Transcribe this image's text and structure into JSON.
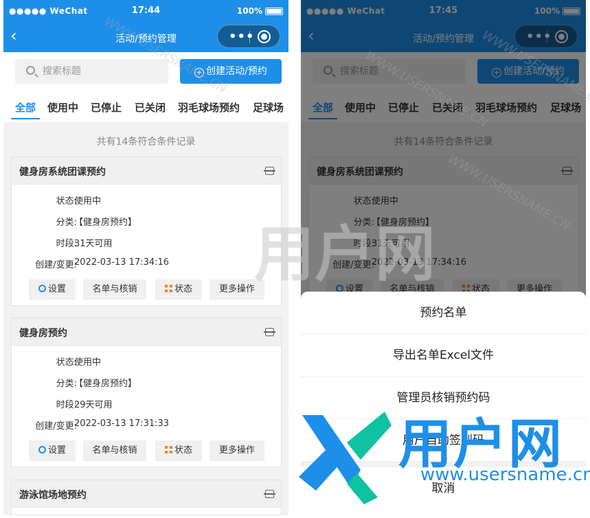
{
  "status_bar_left": {
    "carrier": "●●●●● WeChat",
    "time": "17:44",
    "battery": "100%"
  },
  "status_bar_right": {
    "carrier": "●●●●● WeChat",
    "time": "17:45",
    "battery": "100%"
  },
  "navbar": {
    "title": "活动/预约管理",
    "back_icon": "‹",
    "capsule_dots": "•••"
  },
  "search": {
    "placeholder": "搜索标题"
  },
  "create_button": {
    "label": "创建活动/预约"
  },
  "tabs": [
    "全部",
    "使用中",
    "已停止",
    "已关闭",
    "羽毛球场预约",
    "足球场"
  ],
  "record_count": "共有14条符合条件记录",
  "labels": {
    "status": "状态:",
    "category": "分类:",
    "period": "时段:",
    "updated": "创建/变更:"
  },
  "action_buttons": {
    "settings": "设置",
    "roster": "名单与核销",
    "status": "状态",
    "more": "更多操作"
  },
  "cards": [
    {
      "title": "健身房系统团课预约",
      "status": "使用中",
      "category": "【健身房预约】",
      "period": "31天可用",
      "updated": "2022-03-13 17:34:16"
    },
    {
      "title": "健身房预约",
      "status": "使用中",
      "category": "【健身房预约】",
      "period": "29天可用",
      "updated": "2022-03-13 17:31:33"
    },
    {
      "title": "游泳馆场地预约"
    }
  ],
  "action_sheet": {
    "items": [
      "预约名单",
      "导出名单Excel文件",
      "管理员核销预约码",
      "用户自助签到码"
    ],
    "cancel": "取消"
  },
  "watermark": {
    "url_text": "WWW.USERSNAME.CN",
    "logo_cn": "用户网",
    "logo_url": "www.usersname.cn"
  },
  "colors": {
    "primary": "#1e8fe8",
    "accent_orange": "#f57f2a",
    "background": "#f2f2f2"
  }
}
